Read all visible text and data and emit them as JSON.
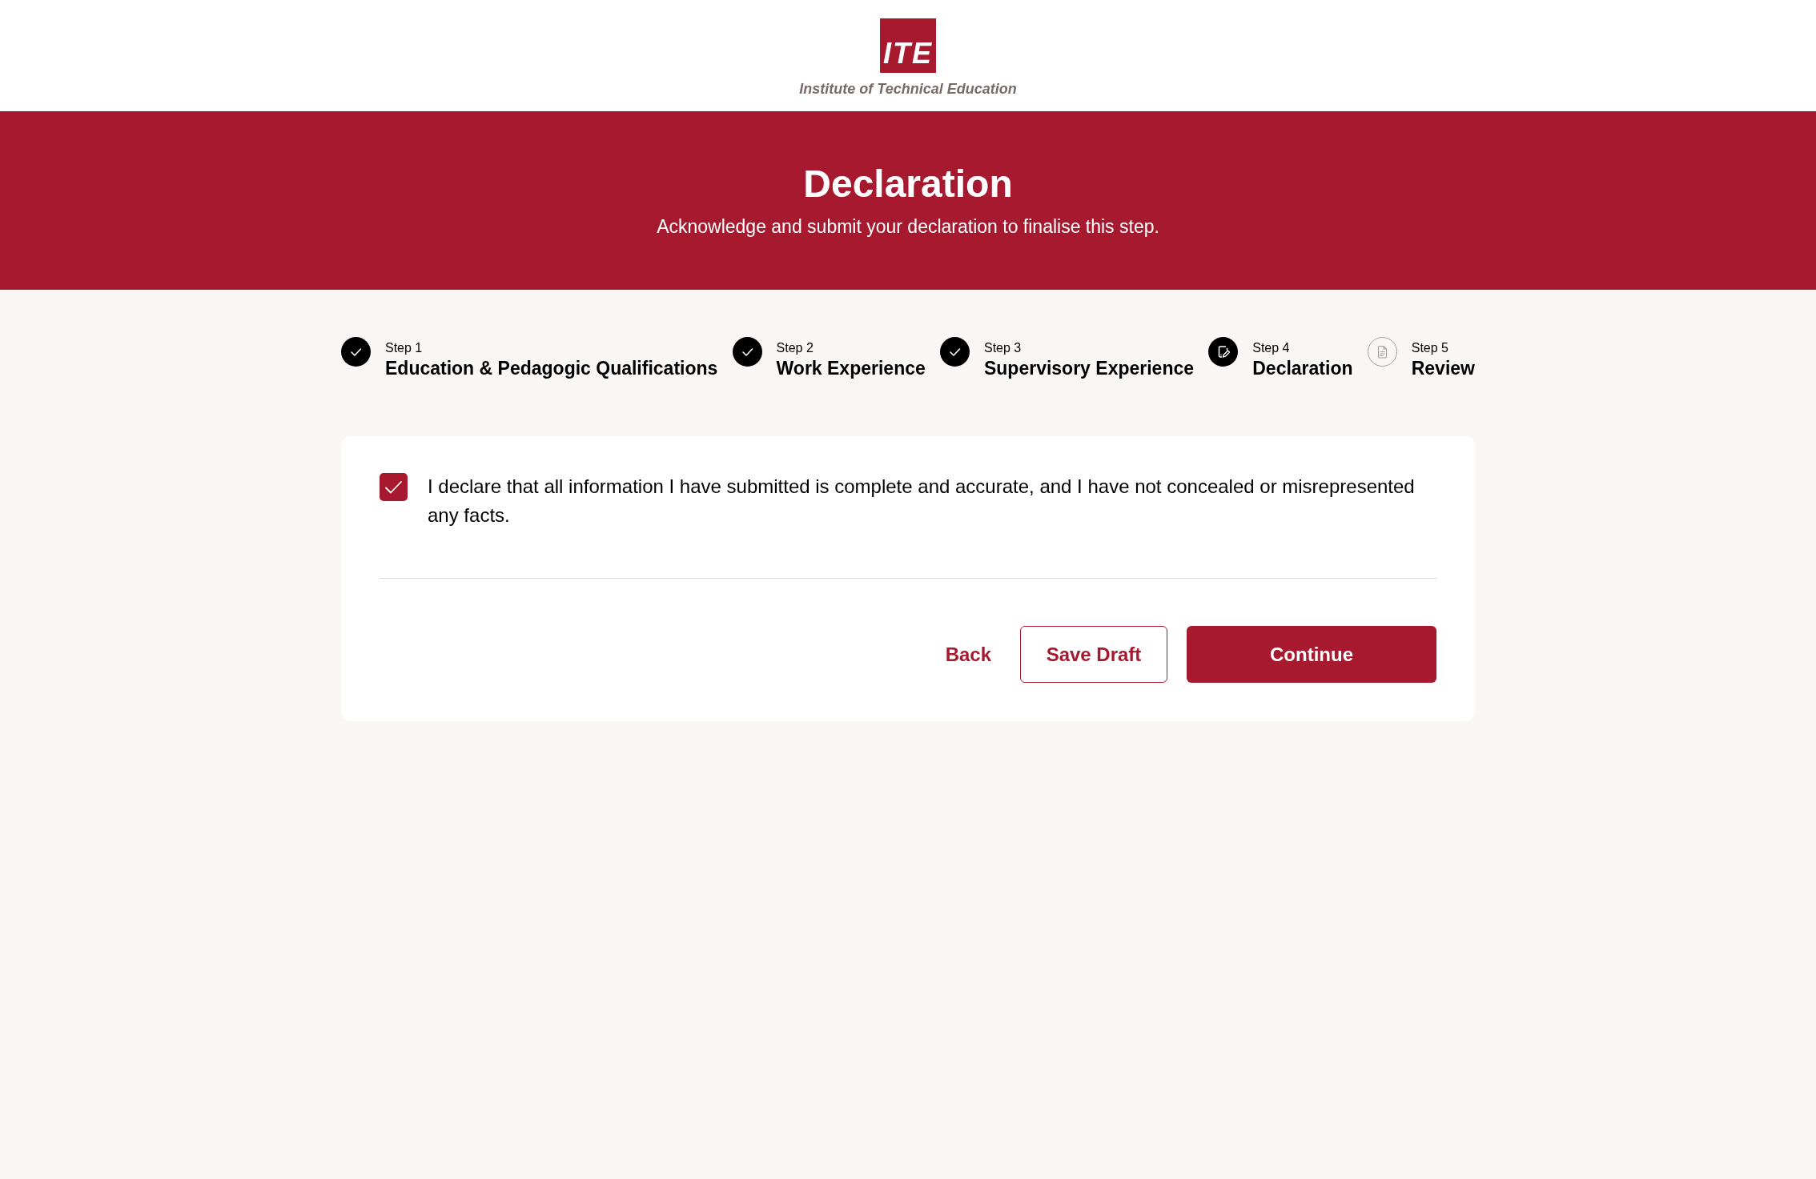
{
  "logo": {
    "mark": "ITE",
    "name": "Institute of Technical Education"
  },
  "banner": {
    "title": "Declaration",
    "subtitle": "Acknowledge and submit your declaration to finalise this step."
  },
  "steps": [
    {
      "number": "Step 1",
      "title": "Education & Pedagogic Qualifications",
      "kind": "completed"
    },
    {
      "number": "Step 2",
      "title": "Work Experience",
      "kind": "completed"
    },
    {
      "number": "Step 3",
      "title": "Supervisory Experience",
      "kind": "completed"
    },
    {
      "number": "Step 4",
      "title": "Declaration",
      "kind": "current"
    },
    {
      "number": "Step 5",
      "title": "Review",
      "kind": "upcoming"
    }
  ],
  "declaration": {
    "checked": true,
    "text": "I declare that all information I have submitted is complete and accurate, and I have not concealed or misrepresented any facts."
  },
  "actions": [
    {
      "label": "Back",
      "kind": "text"
    },
    {
      "label": "Save Draft",
      "kind": "outline"
    },
    {
      "label": "Continue",
      "kind": "primary"
    }
  ]
}
